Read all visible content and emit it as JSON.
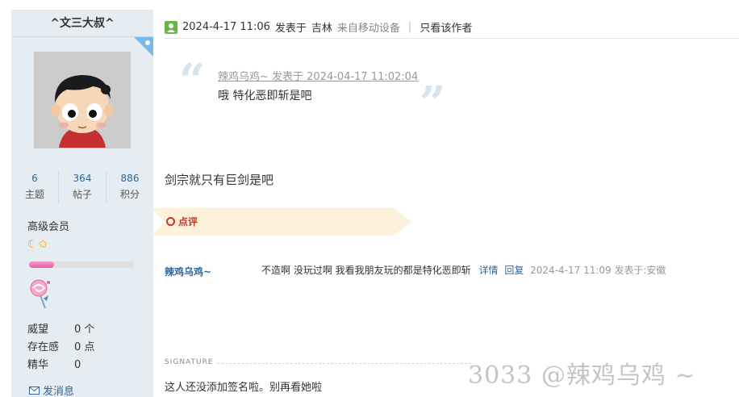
{
  "author": {
    "name": "^文三大叔^",
    "stats": [
      {
        "value": "6",
        "label": "主题"
      },
      {
        "value": "364",
        "label": "帖子"
      },
      {
        "value": "886",
        "label": "积分"
      }
    ],
    "rank": "高级会员",
    "rank_icons": "☾✩",
    "level_progress": 0.24,
    "attrs": [
      {
        "key": "威望",
        "value": "0 个"
      },
      {
        "key": "存在感",
        "value": "0 点"
      },
      {
        "key": "精华",
        "value": "0"
      }
    ],
    "send_message": "发消息"
  },
  "post": {
    "datetime": "2024-4-17 11:06",
    "posted_label": "发表于",
    "location": "吉林",
    "device": "来自移动设备",
    "separator": "|",
    "only_author": "只看该作者",
    "quote": {
      "author_line": "辣鸡乌鸡~ 发表于 2024-04-17 11:02:04",
      "text": "哦 特化恶即斩是吧"
    },
    "message": "剑宗就只有巨剑是吧",
    "review_label": "点评",
    "comment": {
      "user": "辣鸡乌鸡~",
      "text": "不造啊 没玩过啊 我看我朋友玩的都是特化恶即斩",
      "detail": "详情",
      "reply": "回复",
      "time": "2024-4-17 11:09 发表于:安徽"
    },
    "signature_label": "SIGNATURE",
    "signature": "这人还没添加签名啦。别再看她啦"
  },
  "watermark": "3033 @辣鸡乌鸡 ~",
  "colors": {
    "sidebar_bg": "#e5edf2",
    "link": "#336699",
    "review_red": "#c0392b",
    "ribbon": "#fdf1dc"
  }
}
